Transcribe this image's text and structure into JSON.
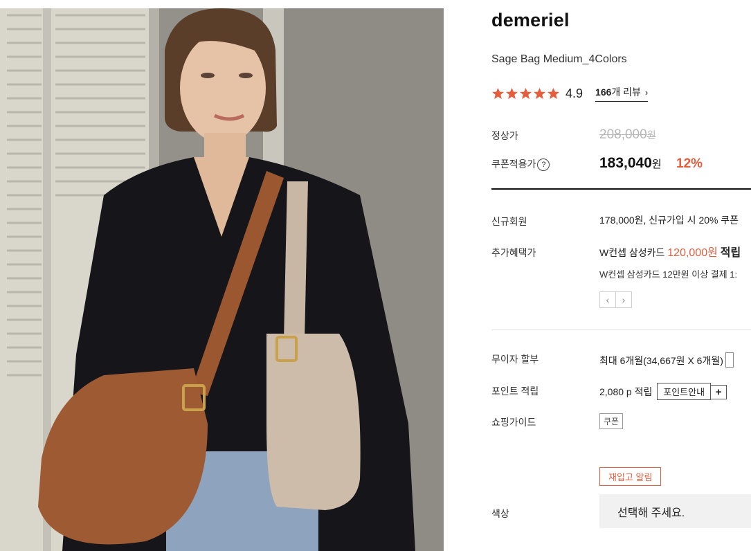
{
  "product": {
    "brand": "demeriel",
    "name": "Sage Bag Medium_4Colors",
    "rating": "4.9",
    "review_count": "166",
    "review_suffix": "개 리뷰",
    "review_chevron": "›",
    "star_color": "#e45e3e",
    "star_count": 5
  },
  "price": {
    "regular_label": "정상가",
    "regular_value": "208,000",
    "regular_unit": "원",
    "coupon_label": "쿠폰적용가",
    "coupon_help": "?",
    "coupon_value": "183,040",
    "coupon_unit": "원",
    "discount": "12%",
    "accent_color": "#e45e3e"
  },
  "benefits": {
    "new_member_label": "신규회원",
    "new_member_value": "178,000원, 신규가입 시 20% 쿠폰",
    "extra_label": "추가혜택가",
    "extra_card_prefix": "W컨셉 삼성카드",
    "extra_card_price": "120,000원",
    "extra_card_suffix": "적립",
    "extra_note": "W컨셉 삼성카드 12만원 이상 결제 1:",
    "prev_arrow": "‹",
    "next_arrow": "›"
  },
  "payment": {
    "installment_label": "무이자 할부",
    "installment_value": "최대 6개월(34,667원 X 6개월)",
    "points_label": "포인트 적립",
    "points_value": "2,080 p 적립",
    "points_guide_btn": "포인트안내",
    "points_plus": "+",
    "shopping_guide_label": "쇼핑가이드",
    "coupon_tag": "쿠폰"
  },
  "options": {
    "restock_btn": "재입고 알림",
    "color_label": "색상",
    "color_placeholder": "선택해 주세요."
  }
}
